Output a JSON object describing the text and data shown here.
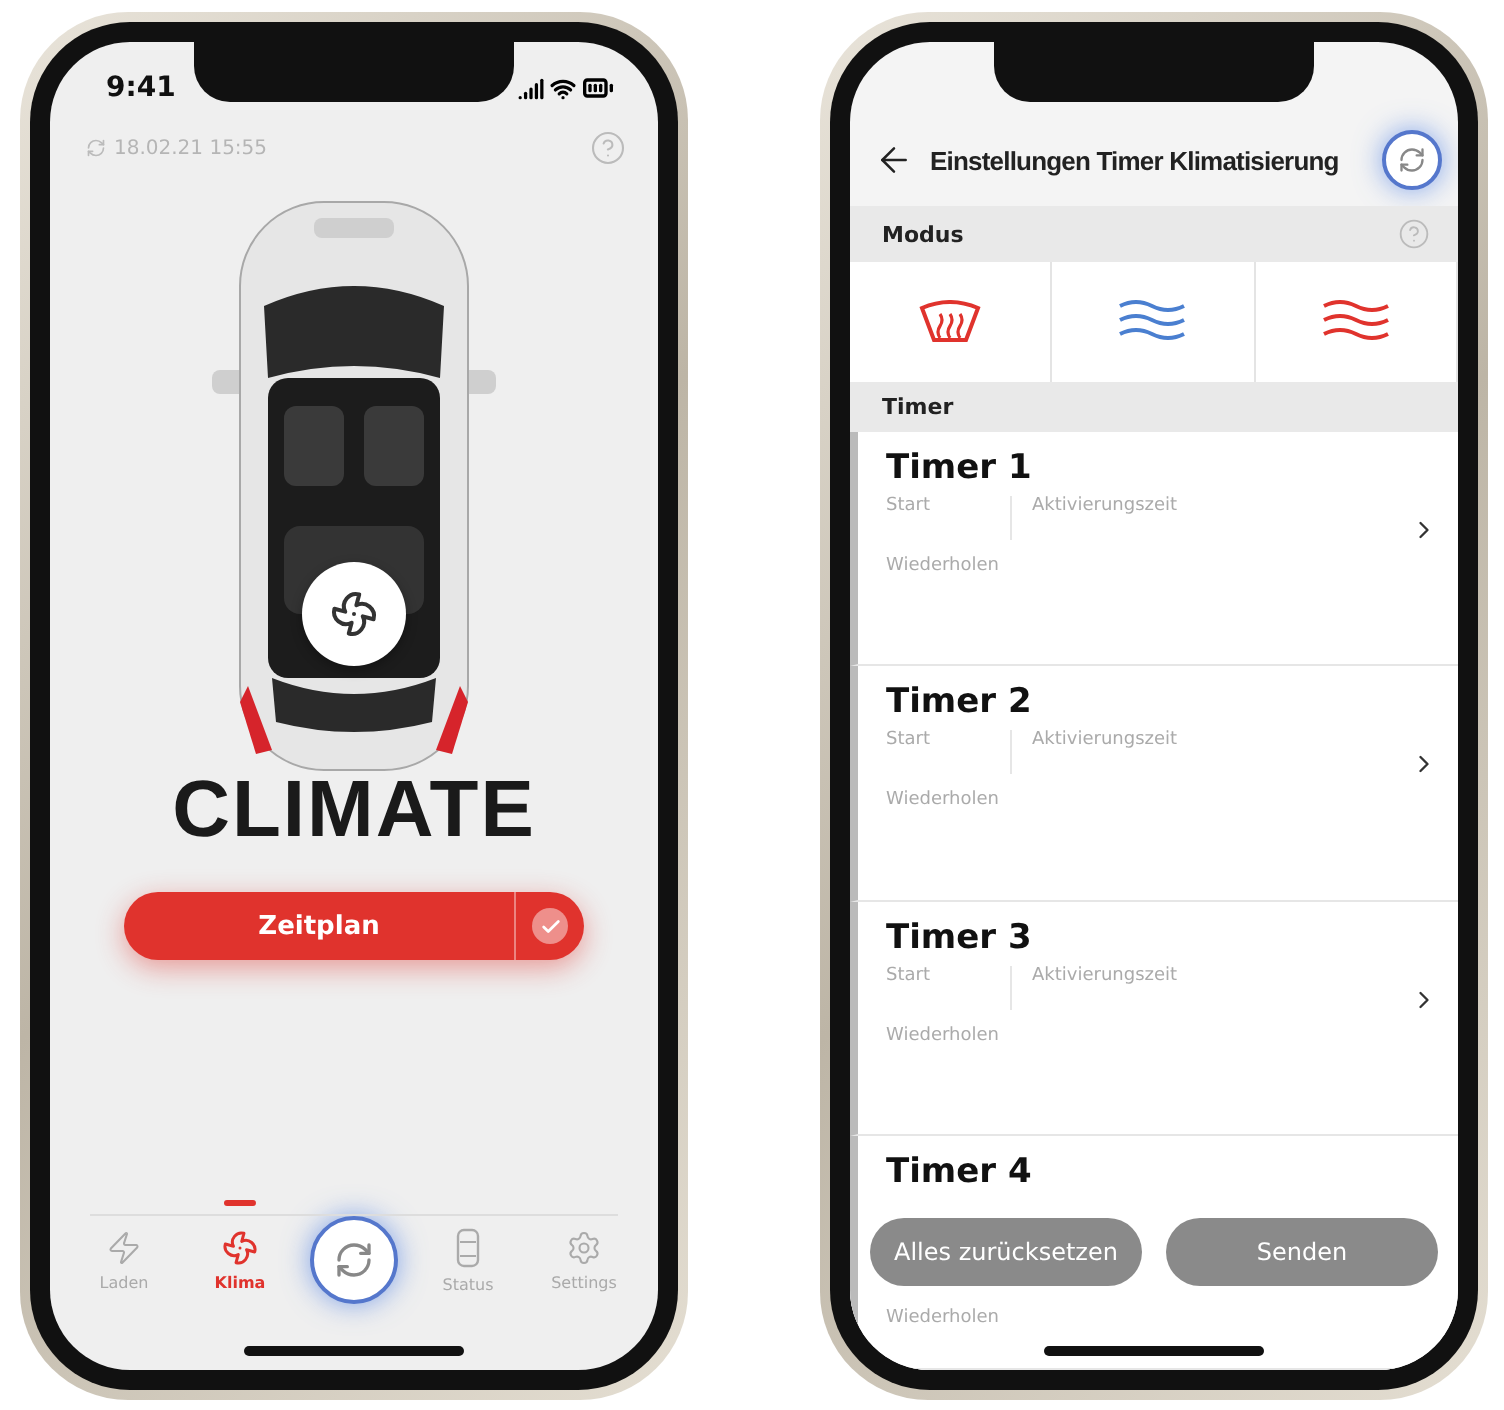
{
  "left_screen": {
    "status_bar": {
      "time": "9:41"
    },
    "last_sync": "18.02.21 15:55",
    "headline": "CLIMATE",
    "schedule_button": {
      "label": "Zeitplan",
      "checked": true
    },
    "nav": [
      {
        "label": "Laden",
        "selected": false
      },
      {
        "label": "Klima",
        "selected": true
      },
      {
        "label": "Status",
        "selected": false
      },
      {
        "label": "Settings",
        "selected": false
      }
    ]
  },
  "right_screen": {
    "title": "Einstellungen Timer Klimatisierung",
    "mode_label": "Modus",
    "modes": [
      {
        "kind": "defrost"
      },
      {
        "kind": "cool"
      },
      {
        "kind": "heat"
      }
    ],
    "timer_label": "Timer",
    "timers": [
      {
        "title": "Timer 1",
        "start": "Start",
        "activation": "Aktivierungszeit",
        "repeat": "Wiederholen"
      },
      {
        "title": "Timer 2",
        "start": "Start",
        "activation": "Aktivierungszeit",
        "repeat": "Wiederholen"
      },
      {
        "title": "Timer 3",
        "start": "Start",
        "activation": "Aktivierungszeit",
        "repeat": "Wiederholen"
      },
      {
        "title": "Timer 4",
        "repeat": "Wiederholen"
      }
    ],
    "buttons": [
      {
        "label": "Alles zurücksetzen"
      },
      {
        "label": "Senden"
      }
    ]
  }
}
